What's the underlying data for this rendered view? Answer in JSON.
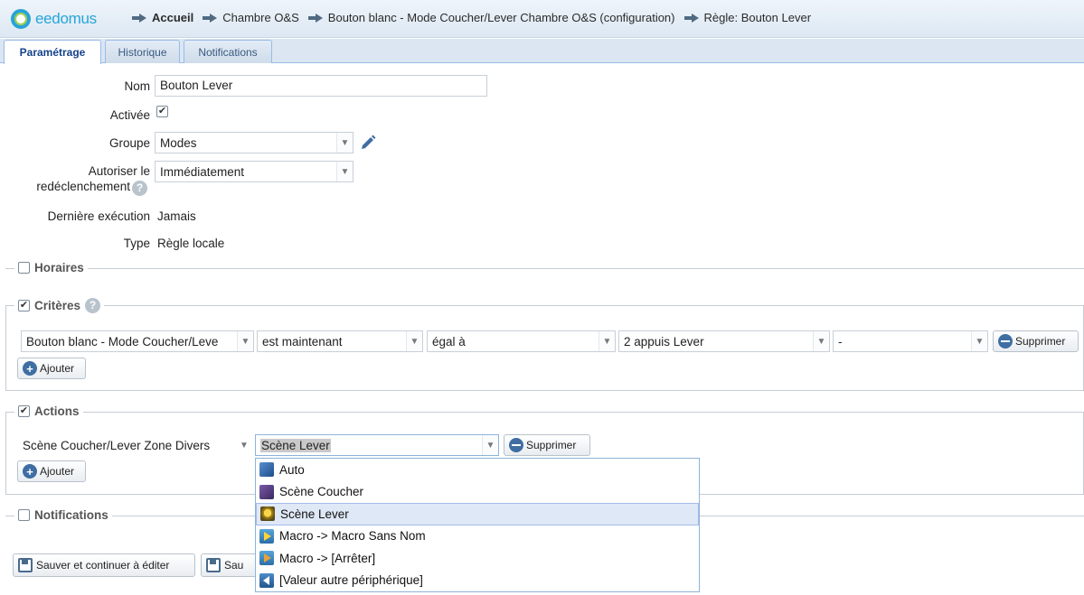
{
  "app": {
    "logo_text": "eedomus"
  },
  "breadcrumb": [
    {
      "label": "Accueil"
    },
    {
      "label": "Chambre O&S"
    },
    {
      "label": "Bouton blanc - Mode Coucher/Lever Chambre O&S (configuration)"
    },
    {
      "label": "Règle: Bouton Lever"
    }
  ],
  "tabs": [
    {
      "label": "Paramétrage",
      "active": true
    },
    {
      "label": "Historique",
      "active": false
    },
    {
      "label": "Notifications",
      "active": false
    }
  ],
  "form": {
    "nom": {
      "label": "Nom",
      "value": "Bouton Lever"
    },
    "activee": {
      "label": "Activée",
      "checked": true
    },
    "groupe": {
      "label": "Groupe",
      "value": "Modes"
    },
    "redeclenchement": {
      "label_line1": "Autoriser le",
      "label_line2": "redéclenchement",
      "value": "Immédiatement"
    },
    "derniere_execution": {
      "label": "Dernière exécution",
      "value": "Jamais"
    },
    "type": {
      "label": "Type",
      "value": "Règle locale"
    }
  },
  "sections": {
    "horaires": {
      "label": "Horaires",
      "checked": false
    },
    "criteres": {
      "label": "Critères",
      "checked": true,
      "row": {
        "device": "Bouton blanc - Mode Coucher/Leve",
        "condition": "est maintenant",
        "operator": "égal à",
        "value": "2 appuis Lever",
        "extra": "-",
        "delete_label": "Supprimer"
      },
      "add_label": "Ajouter"
    },
    "actions": {
      "label": "Actions",
      "checked": true,
      "row": {
        "device": "Scène Coucher/Lever Zone Divers",
        "value": "Scène Lever",
        "delete_label": "Supprimer"
      },
      "add_label": "Ajouter"
    },
    "notifications": {
      "label": "Notifications",
      "checked": false
    }
  },
  "dropdown": {
    "options": [
      {
        "label": "Auto",
        "icon": "auto-icon"
      },
      {
        "label": "Scène Coucher",
        "icon": "scene-coucher-icon"
      },
      {
        "label": "Scène Lever",
        "icon": "scene-lever-icon",
        "selected": true
      },
      {
        "label": "Macro -> Macro Sans Nom",
        "icon": "play-icon"
      },
      {
        "label": "Macro -> [Arrêter]",
        "icon": "stop-icon"
      },
      {
        "label": "[Valeur autre périphérique]",
        "icon": "back-arrow-icon"
      }
    ]
  },
  "footer": {
    "save_continue_label": "Sauver et continuer à éditer",
    "save_label": "Sau"
  },
  "colors": {
    "accent": "#15428b",
    "logo": "#27a6d8",
    "selected_row": "#dfe8f6"
  }
}
